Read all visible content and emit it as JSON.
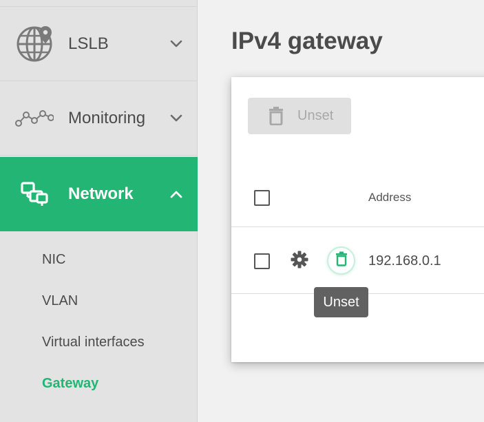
{
  "sidebar": {
    "items": [
      {
        "label": "LSLB",
        "icon": "globe-pin-icon",
        "expanded": false
      },
      {
        "label": "Monitoring",
        "icon": "line-graph-icon",
        "expanded": false
      },
      {
        "label": "Network",
        "icon": "network-icon",
        "expanded": true,
        "active": true
      }
    ],
    "sub_items": [
      {
        "label": "NIC",
        "active": false
      },
      {
        "label": "VLAN",
        "active": false
      },
      {
        "label": "Virtual interfaces",
        "active": false
      },
      {
        "label": "Gateway",
        "active": true
      }
    ]
  },
  "main": {
    "title": "IPv4 gateway",
    "toolbar": {
      "unset_label": "Unset",
      "unset_disabled": true
    },
    "table": {
      "columns": [
        "Address"
      ],
      "rows": [
        {
          "address": "192.168.0.1",
          "checked": false
        }
      ]
    },
    "tooltip": "Unset"
  },
  "colors": {
    "accent": "#22b573",
    "sidebar_bg": "#e3e3e3",
    "page_bg": "#f1f1f1",
    "tooltip_bg": "#616161"
  }
}
